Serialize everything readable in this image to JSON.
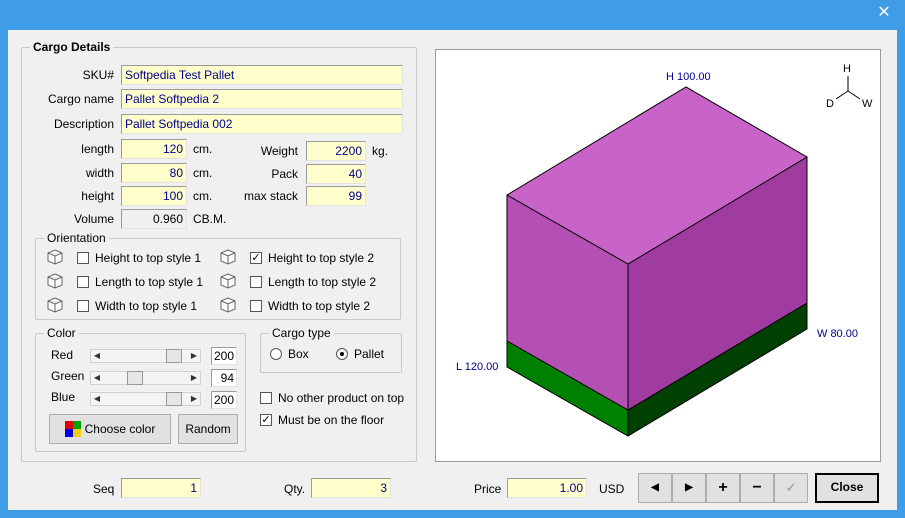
{
  "window": {
    "close_glyph": "✕"
  },
  "cargo_details": {
    "title": "Cargo Details",
    "sku_label": "SKU#",
    "sku": "Softpedia Test Pallet",
    "name_label": "Cargo name",
    "name": "Pallet Softpedia 2",
    "desc_label": "Description",
    "desc": "Pallet Softpedia 002",
    "length_label": "length",
    "length": "120",
    "length_unit": "cm.",
    "width_label": "width",
    "width": "80",
    "width_unit": "cm.",
    "height_label": "height",
    "height": "100",
    "height_unit": "cm.",
    "volume_label": "Volume",
    "volume": "0.960",
    "volume_unit": "CB.M.",
    "weight_label": "Weight",
    "weight": "2200",
    "weight_unit": "kg.",
    "pack_label": "Pack",
    "pack": "40",
    "maxstack_label": "max stack",
    "maxstack": "99"
  },
  "orientation": {
    "title": "Orientation",
    "options": [
      {
        "label": "Height to top style 1",
        "checked": false
      },
      {
        "label": "Height to top style 2",
        "checked": true
      },
      {
        "label": "Length to top style 1",
        "checked": false
      },
      {
        "label": "Length to top style 2",
        "checked": false
      },
      {
        "label": "Width to top style 1",
        "checked": false
      },
      {
        "label": "Width to top style 2",
        "checked": false
      }
    ],
    "check_mark": "✓"
  },
  "color": {
    "title": "Color",
    "red_label": "Red",
    "red": "200",
    "green_label": "Green",
    "green": "94",
    "blue_label": "Blue",
    "blue": "200",
    "choose_label": "Choose color",
    "random_label": "Random",
    "left_arrow": "◀",
    "right_arrow": "▶"
  },
  "cargo_type": {
    "title": "Cargo type",
    "box_label": "Box",
    "pallet_label": "Pallet",
    "selected": "Pallet"
  },
  "options": {
    "no_other_label": "No other product on top",
    "no_other": false,
    "floor_label": "Must be on the floor",
    "floor": true
  },
  "view3d": {
    "h_label": "H 100.00",
    "w_label": "W 80.00",
    "l_label": "L 120.00",
    "axis_h": "H",
    "axis_d": "D",
    "axis_w": "W",
    "colors": {
      "top": "#c864c8",
      "left": "#b450b4",
      "right": "#a03ca0",
      "pallet_left": "#008000",
      "pallet_right": "#004000"
    }
  },
  "footer": {
    "seq_label": "Seq",
    "seq": "1",
    "qty_label": "Qty.",
    "qty": "3",
    "price_label": "Price",
    "price": "1.00",
    "currency": "USD",
    "prev": "◀",
    "next": "▶",
    "add": "+",
    "remove": "−",
    "confirm": "✓",
    "close_label": "Close"
  }
}
